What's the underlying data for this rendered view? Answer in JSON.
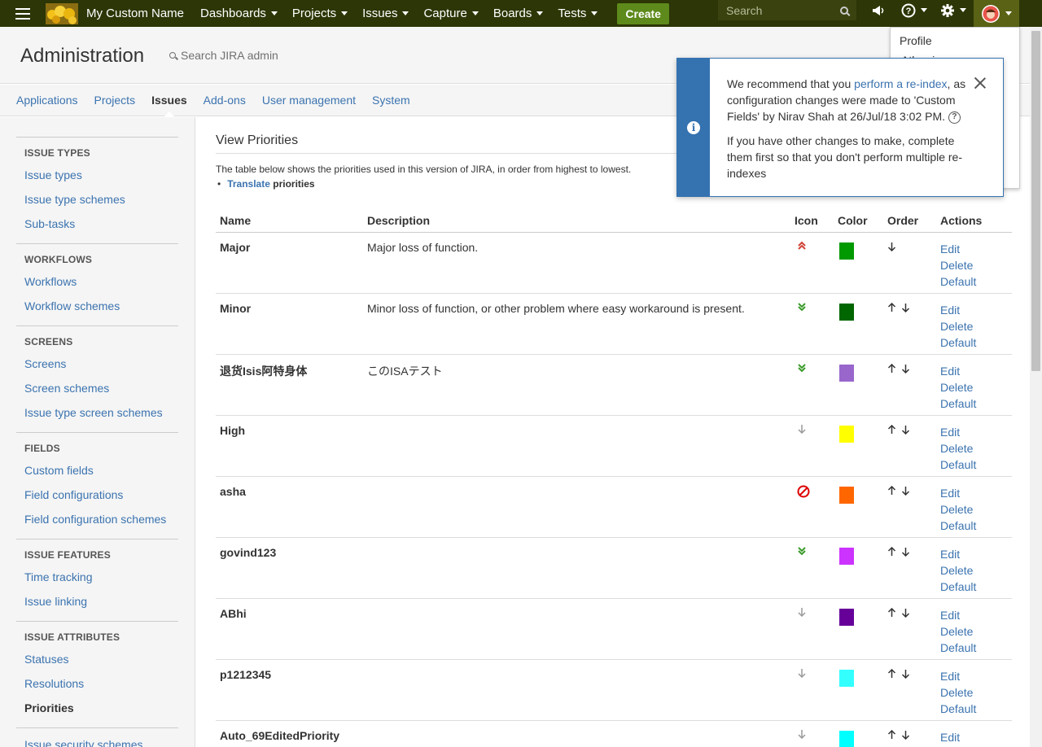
{
  "topnav": {
    "brand": "My Custom Name",
    "menus": [
      "Dashboards",
      "Projects",
      "Issues",
      "Capture",
      "Boards",
      "Tests"
    ],
    "create_label": "Create",
    "search_placeholder": "Search"
  },
  "admin": {
    "title": "Administration",
    "search_placeholder": "Search JIRA admin"
  },
  "tabs": [
    {
      "label": "Applications",
      "active": false
    },
    {
      "label": "Projects",
      "active": false
    },
    {
      "label": "Issues",
      "active": true
    },
    {
      "label": "Add-ons",
      "active": false
    },
    {
      "label": "User management",
      "active": false
    },
    {
      "label": "System",
      "active": false
    }
  ],
  "sidebar": [
    {
      "heading": "ISSUE TYPES",
      "items": [
        "Issue types",
        "Issue type schemes",
        "Sub-tasks"
      ]
    },
    {
      "heading": "WORKFLOWS",
      "items": [
        "Workflows",
        "Workflow schemes"
      ]
    },
    {
      "heading": "SCREENS",
      "items": [
        "Screens",
        "Screen schemes",
        "Issue type screen schemes"
      ]
    },
    {
      "heading": "FIELDS",
      "items": [
        "Custom fields",
        "Field configurations",
        "Field configuration schemes"
      ]
    },
    {
      "heading": "ISSUE FEATURES",
      "items": [
        "Time tracking",
        "Issue linking"
      ]
    },
    {
      "heading": "ISSUE ATTRIBUTES",
      "items": [
        "Statuses",
        "Resolutions",
        "Priorities"
      ],
      "active": "Priorities"
    },
    {
      "heading": "",
      "items": [
        "Issue security schemes"
      ]
    }
  ],
  "main": {
    "title": "View Priorities",
    "intro": "The table below shows the priorities used in this version of JIRA, in order from highest to lowest.",
    "translate_link": "Translate",
    "translate_suffix": " priorities",
    "columns": [
      "Name",
      "Description",
      "Icon",
      "Color",
      "Order",
      "Actions"
    ],
    "actions": [
      "Edit",
      "Delete",
      "Default"
    ],
    "rows": [
      {
        "name": "Major",
        "description": "Major loss of function.",
        "icon": "double-up-chevron",
        "color": "#009900",
        "order": [
          "down"
        ]
      },
      {
        "name": "Minor",
        "description": "Minor loss of function, or other problem where easy workaround is present.",
        "icon": "double-down-chevron",
        "color": "#006600",
        "order": [
          "up",
          "down"
        ]
      },
      {
        "name": "退货Isis阿特身体",
        "description": "このISAテスト",
        "icon": "double-down-chevron",
        "color": "#9966cc",
        "order": [
          "up",
          "down"
        ]
      },
      {
        "name": "High",
        "description": "",
        "icon": "down-arrow",
        "color": "#ffff00",
        "order": [
          "up",
          "down"
        ]
      },
      {
        "name": "asha",
        "description": "",
        "icon": "blocked",
        "color": "#ff6600",
        "order": [
          "up",
          "down"
        ]
      },
      {
        "name": "govind123",
        "description": "",
        "icon": "double-down-chevron",
        "color": "#cc33ff",
        "order": [
          "up",
          "down"
        ]
      },
      {
        "name": "ABhi",
        "description": "",
        "icon": "down-arrow",
        "color": "#660099",
        "order": [
          "up",
          "down"
        ]
      },
      {
        "name": "p1212345",
        "description": "",
        "icon": "down-arrow",
        "color": "#33ffff",
        "order": [
          "up",
          "down"
        ]
      },
      {
        "name": "Auto_69EditedPriority",
        "description": "",
        "icon": "down-arrow",
        "color": "#00ffff",
        "order": [
          "up",
          "down"
        ]
      }
    ]
  },
  "profile_menu": {
    "items": [
      "Profile",
      "Atlassian Marketplace"
    ]
  },
  "notification": {
    "text_before": "We recommend that you ",
    "link": "perform a re-index",
    "text_after": ", as configuration changes were made to 'Custom Fields' by Nirav Shah at 26/Jul/18 3:02 PM.",
    "text2": "If you have other changes to make, complete them first so that you don't perform multiple re-indexes"
  }
}
